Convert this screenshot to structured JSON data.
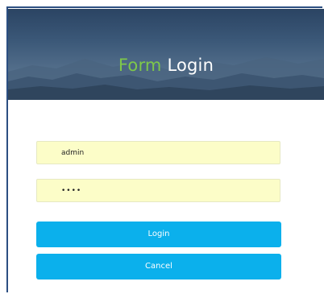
{
  "header": {
    "title_accent": "Form",
    "title_main": " Login"
  },
  "form": {
    "username_value": "admin",
    "password_value": "••••",
    "login_label": "Login",
    "cancel_label": "Cancel"
  },
  "colors": {
    "accent_green": "#7ec84a",
    "button_blue": "#0bb0ec",
    "input_background": "#fcfdc8",
    "frame_border": "#2c4f82"
  }
}
